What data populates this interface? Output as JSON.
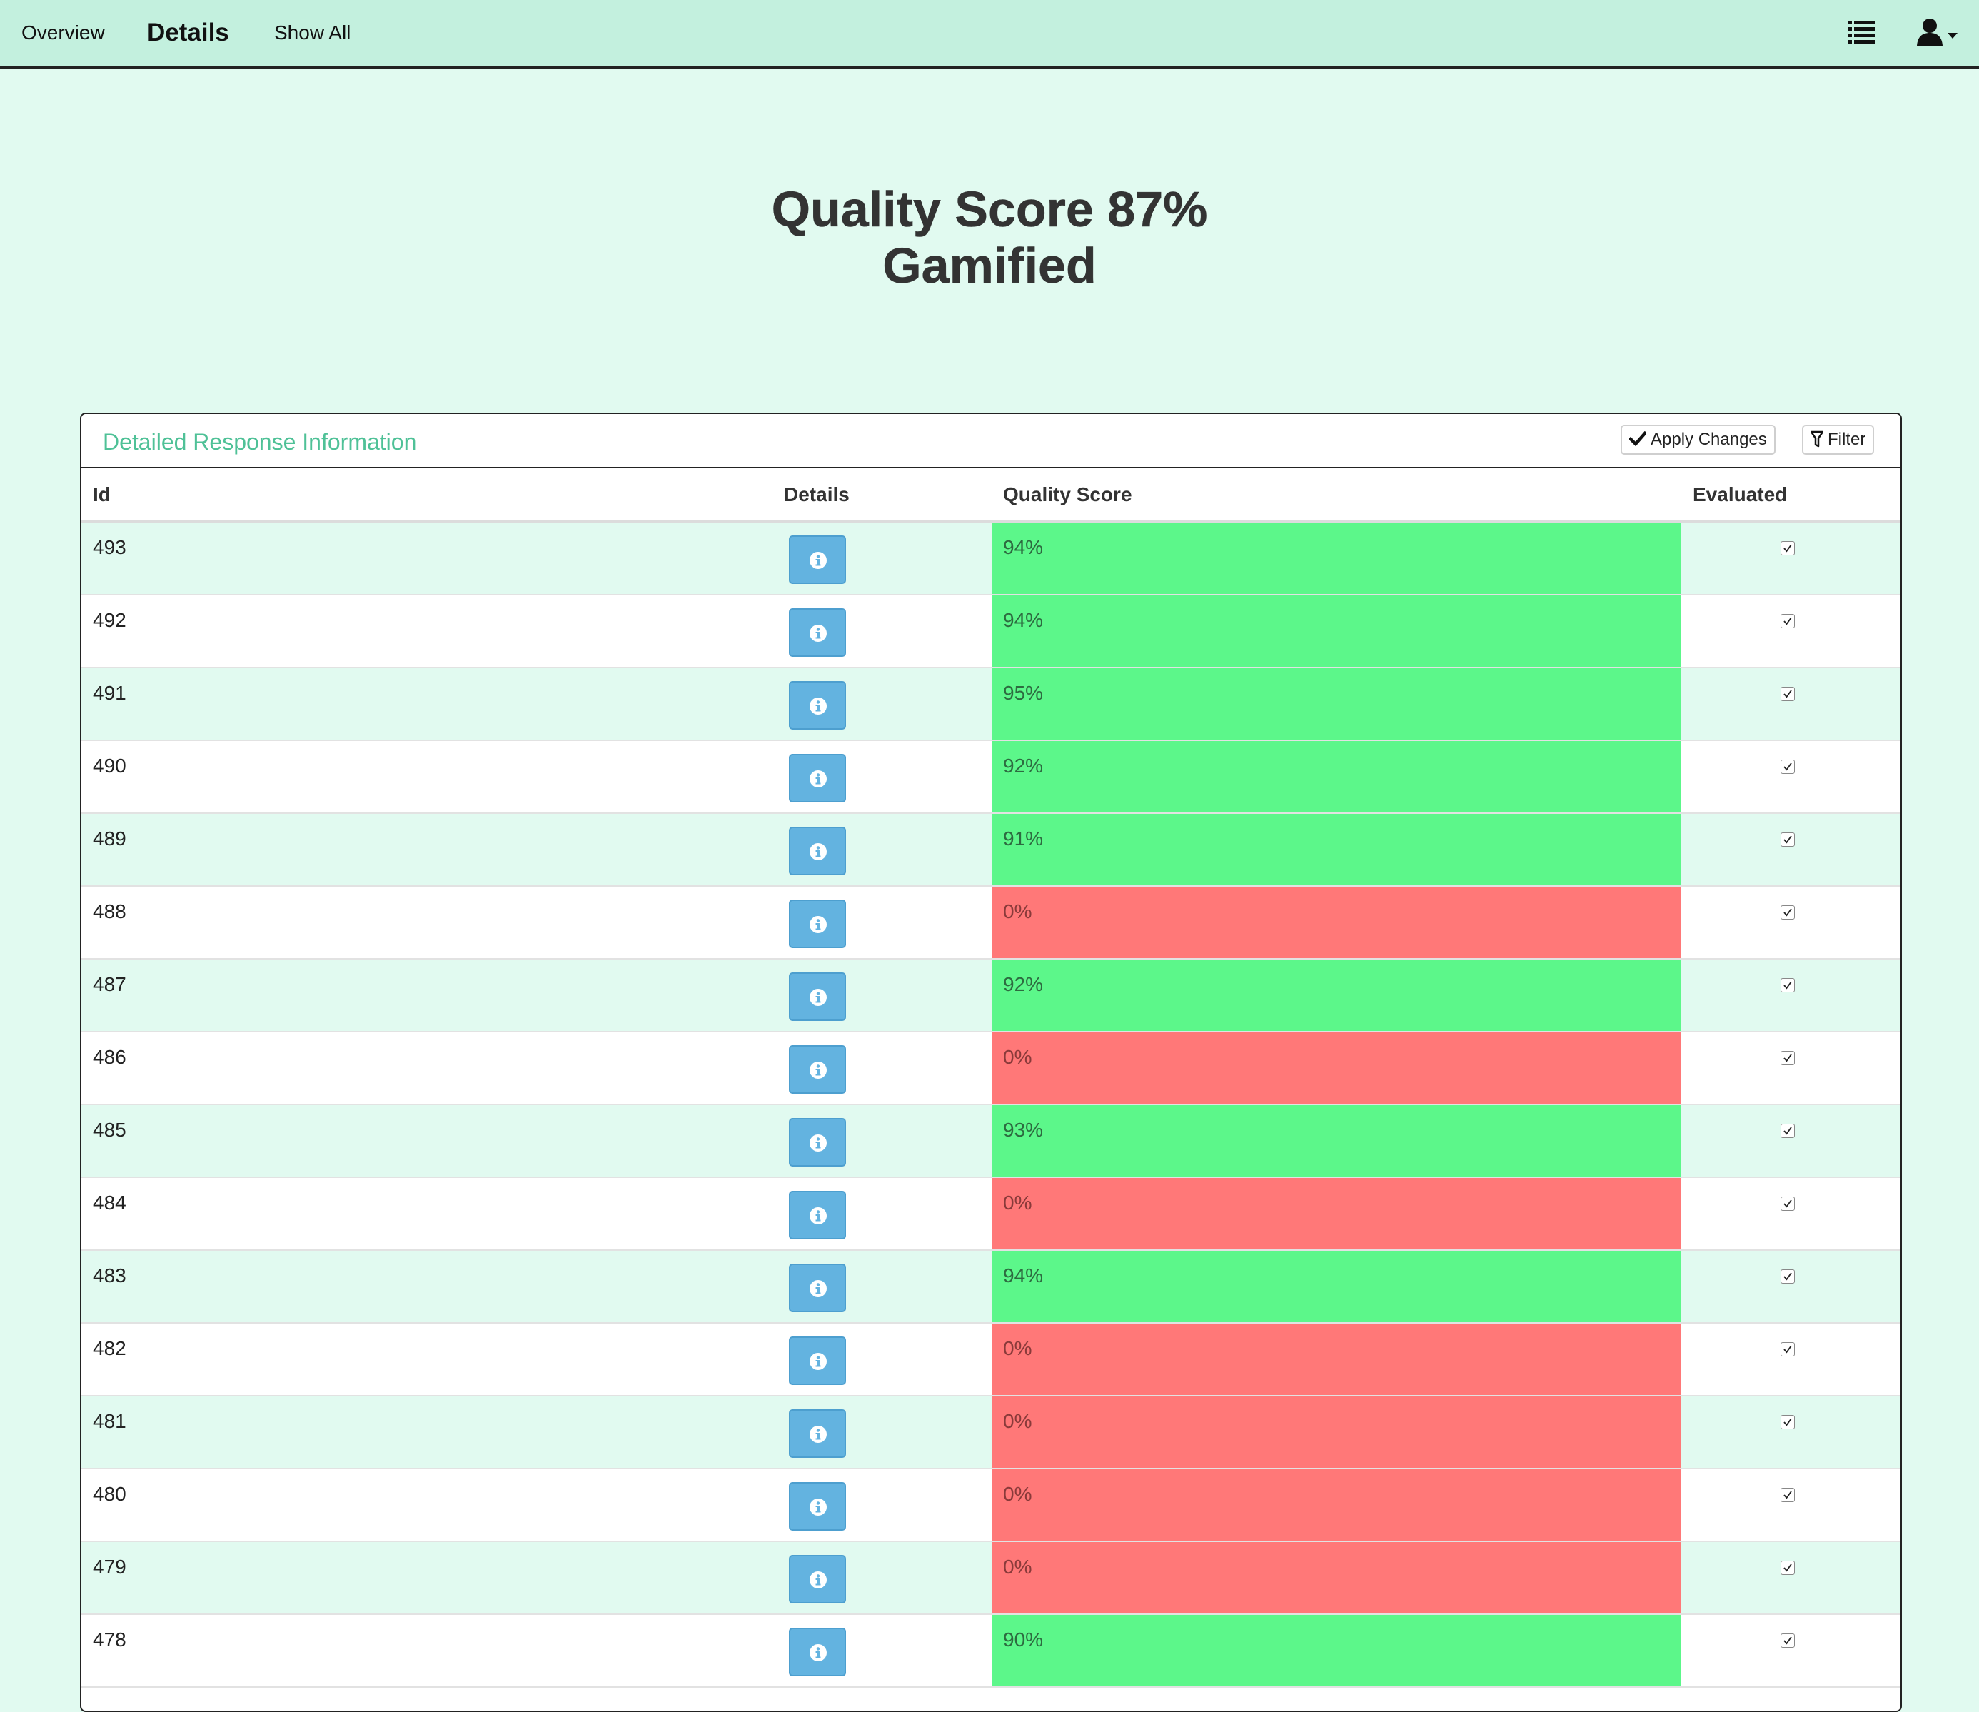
{
  "nav": {
    "links": [
      {
        "label": "Overview",
        "active": false
      },
      {
        "label": "Details",
        "active": true
      },
      {
        "label": "Show All",
        "active": false
      }
    ],
    "icons": [
      "list-icon",
      "user-icon"
    ]
  },
  "heading": {
    "line1": "Quality Score 87%",
    "line2": "Gamified"
  },
  "panel": {
    "title": "Detailed Response Information",
    "apply_label": "Apply Changes",
    "filter_label": "Filter"
  },
  "table": {
    "columns": [
      "Id",
      "Details",
      "Quality Score",
      "Evaluated"
    ],
    "rows": [
      {
        "id": "493",
        "score": "94%",
        "evaluated": true
      },
      {
        "id": "492",
        "score": "94%",
        "evaluated": true
      },
      {
        "id": "491",
        "score": "95%",
        "evaluated": true
      },
      {
        "id": "490",
        "score": "92%",
        "evaluated": true
      },
      {
        "id": "489",
        "score": "91%",
        "evaluated": true
      },
      {
        "id": "488",
        "score": "0%",
        "evaluated": true
      },
      {
        "id": "487",
        "score": "92%",
        "evaluated": true
      },
      {
        "id": "486",
        "score": "0%",
        "evaluated": true
      },
      {
        "id": "485",
        "score": "93%",
        "evaluated": true
      },
      {
        "id": "484",
        "score": "0%",
        "evaluated": true
      },
      {
        "id": "483",
        "score": "94%",
        "evaluated": true
      },
      {
        "id": "482",
        "score": "0%",
        "evaluated": true
      },
      {
        "id": "481",
        "score": "0%",
        "evaluated": true
      },
      {
        "id": "480",
        "score": "0%",
        "evaluated": true
      },
      {
        "id": "479",
        "score": "0%",
        "evaluated": true
      },
      {
        "id": "478",
        "score": "90%",
        "evaluated": true
      }
    ]
  },
  "colors": {
    "navbar": "#c3f0de",
    "background": "#e1faf0",
    "panel_title": "#4fc197",
    "score_good": "#5cf78a",
    "score_bad": "#ff7878",
    "info_button": "#63b3e0"
  }
}
